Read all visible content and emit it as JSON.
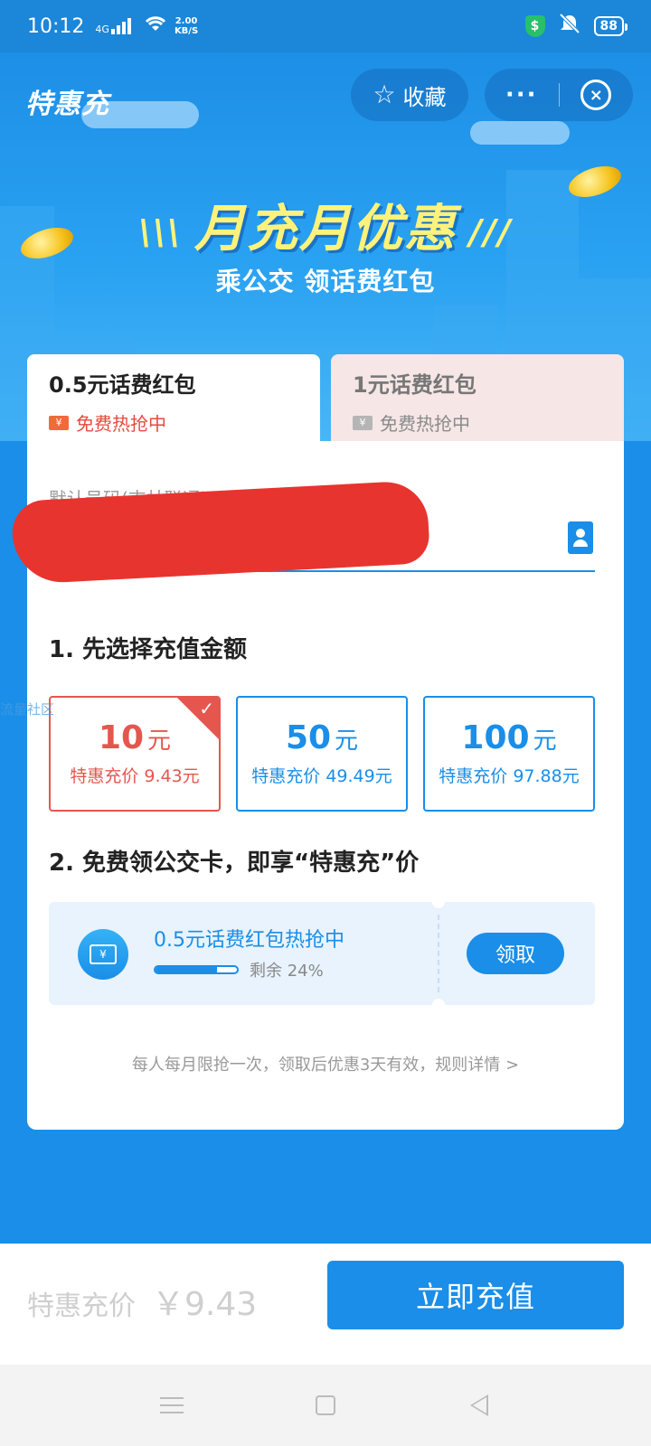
{
  "status_bar": {
    "time": "10:12",
    "network": "4G",
    "net_speed_value": "2.00",
    "net_speed_unit": "KB/S",
    "battery": "88"
  },
  "header": {
    "brand": "特惠充",
    "favorite_label": "收藏"
  },
  "hero": {
    "title": "月充月优惠",
    "subtitle": "乘公交 领话费红包"
  },
  "tabs": [
    {
      "title": "0.5元话费红包",
      "sub": "免费热抢中",
      "active": true
    },
    {
      "title": "1元话费红包",
      "sub": "免费热抢中",
      "active": false
    }
  ],
  "phone": {
    "label": "默认号码(吉林联通)"
  },
  "step1": {
    "title": "1. 先选择充值金额",
    "amounts": [
      {
        "value": "10",
        "unit": "元",
        "price": "特惠充价 9.43元",
        "selected": true
      },
      {
        "value": "50",
        "unit": "元",
        "price": "特惠充价 49.49元",
        "selected": false
      },
      {
        "value": "100",
        "unit": "元",
        "price": "特惠充价 97.88元",
        "selected": false
      }
    ]
  },
  "step2": {
    "title": "2. 免费领公交卡，即享“特惠充”价",
    "coupon_title": "0.5元话费红包热抢中",
    "remaining_label": "剩余 24%",
    "remaining_fraction": 0.76,
    "claim_label": "领取"
  },
  "rules": "每人每月限抢一次，领取后优惠3天有效，规则详情 >",
  "watermark": "流量社区",
  "bottom": {
    "price_label": "特惠充价",
    "price_value": "￥9.43",
    "pay_label": "立即充值"
  },
  "colors": {
    "brand_blue": "#1a8ee8",
    "selected_red": "#e5564e",
    "title_yellow": "#fff27a"
  }
}
